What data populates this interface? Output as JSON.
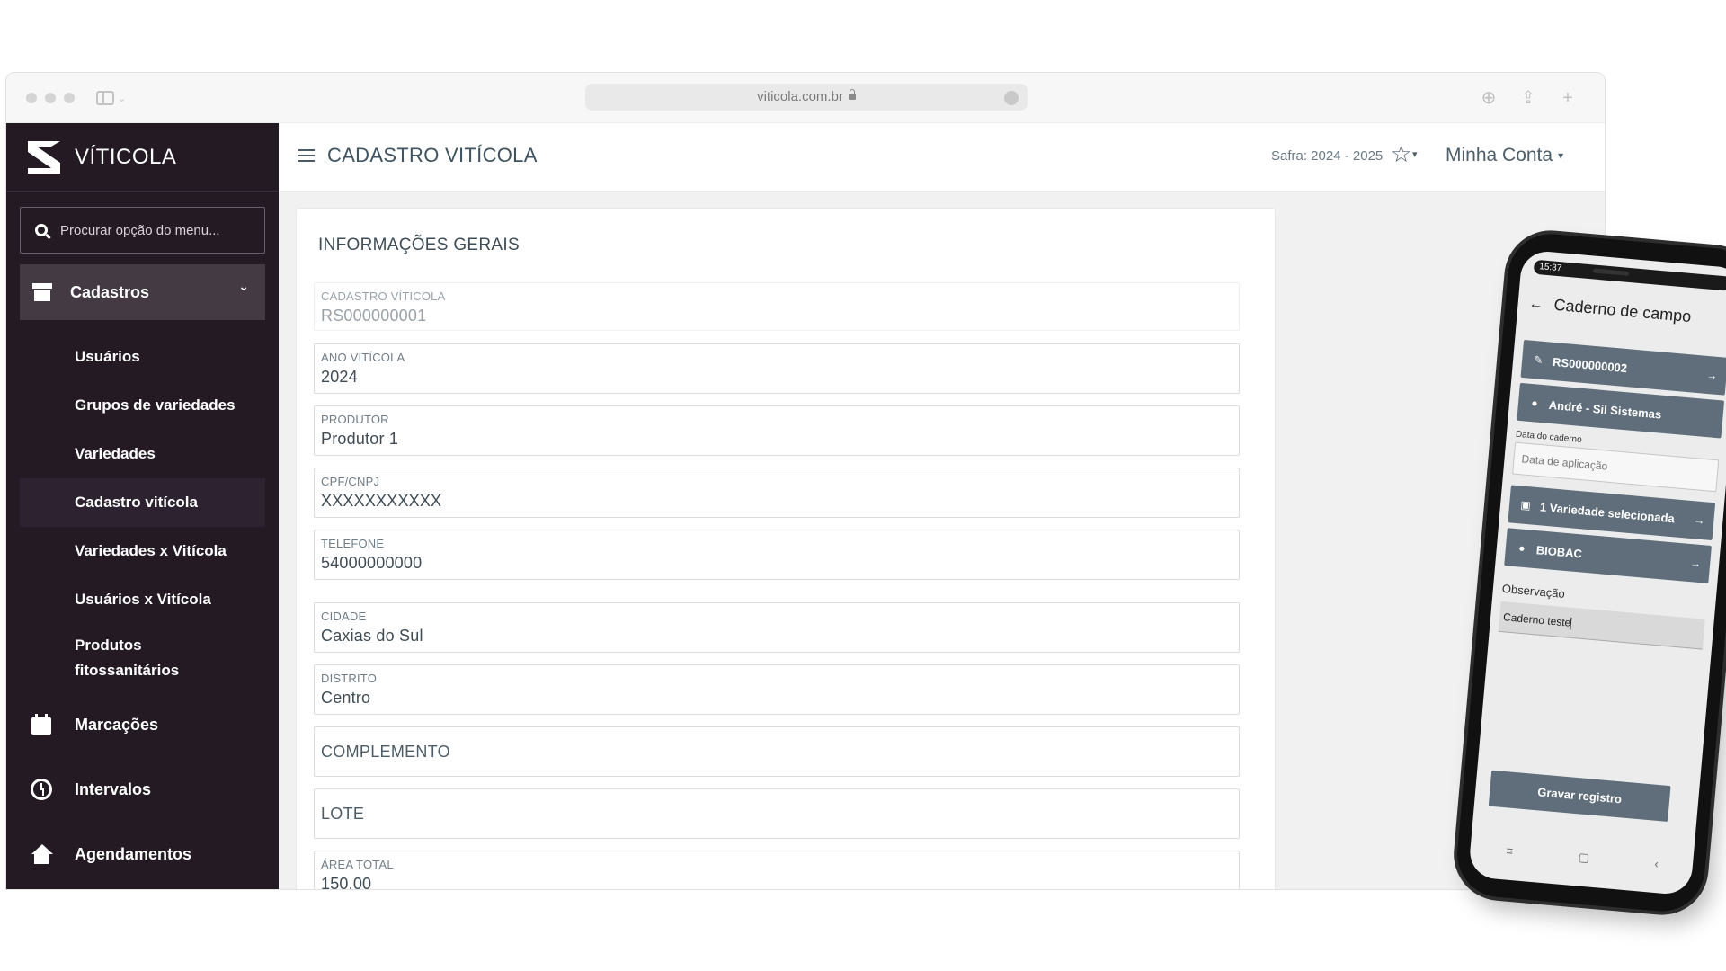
{
  "browser": {
    "url": "viticola.com.br"
  },
  "sidebar": {
    "brand": "VÍTICOLA",
    "search_placeholder": "Procurar opção do menu...",
    "section": "Cadastros",
    "subitems": [
      "Usuários",
      "Grupos de variedades",
      "Variedades",
      "Cadastro vitícola",
      "Variedades x Vitícola",
      "Usuários x Vitícola"
    ],
    "produtos_line1": "Produtos",
    "produtos_line2": "fitossanitários",
    "marcacoes": "Marcações",
    "intervalos": "Intervalos",
    "agendamentos": "Agendamentos"
  },
  "header": {
    "title": "CADASTRO VITÍCOLA",
    "safra": "Safra: 2024 - 2025",
    "account": "Minha Conta"
  },
  "form": {
    "section_title": "INFORMAÇÕES GERAIS",
    "cadastro": {
      "label": "CADASTRO VÍTICOLA",
      "value": "RS000000001"
    },
    "ano": {
      "label": "ANO VITÍCOLA",
      "value": "2024"
    },
    "produtor": {
      "label": "PRODUTOR",
      "value": "Produtor 1"
    },
    "cpf": {
      "label": "CPF/CNPJ",
      "value": "XXXXXXXXXXX"
    },
    "telefone": {
      "label": "TELEFONE",
      "value": "54000000000"
    },
    "cidade": {
      "label": "CIDADE",
      "value": "Caxias do Sul"
    },
    "distrito": {
      "label": "DISTRITO",
      "value": "Centro"
    },
    "complemento": "COMPLEMENTO",
    "lote": "LOTE",
    "area": {
      "label": "ÁREA TOTAL",
      "value": "150,00"
    }
  },
  "phone": {
    "time": "15:37",
    "title": "Caderno de campo",
    "btn_cadastro": "RS000000002",
    "btn_user": "André - Sil Sistemas",
    "data_label": "Data do caderno",
    "data_placeholder": "Data de aplicação",
    "btn_variedade": "1 Variedade selecionada",
    "btn_produto": "BIOBAC",
    "obs_label": "Observação",
    "obs_value": "Caderno teste",
    "save": "Gravar registro"
  }
}
